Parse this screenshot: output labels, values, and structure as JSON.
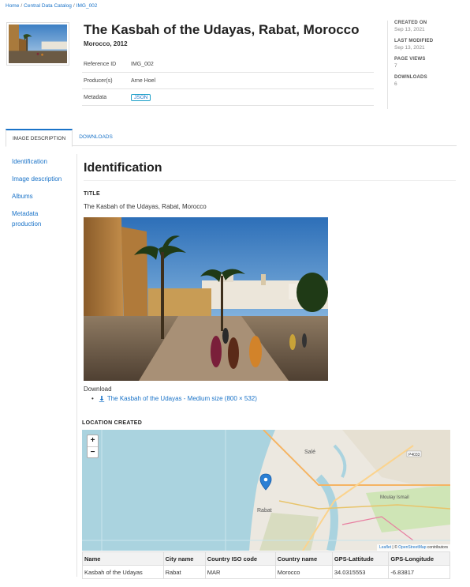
{
  "breadcrumb": {
    "home": "Home",
    "catalog": "Central Data Catalog",
    "current": "IMG_002",
    "separator": "/"
  },
  "header": {
    "title": "The Kasbah of the Udayas, Rabat, Morocco",
    "subtitle": "Morocco, 2012"
  },
  "meta": {
    "reference_id_label": "Reference ID",
    "reference_id": "IMG_002",
    "producer_label": "Producer(s)",
    "producer": "Arne Hoel",
    "metadata_label": "Metadata",
    "metadata_badge": "JSON"
  },
  "stats": {
    "created_label": "CREATED ON",
    "created": "Sep 13, 2021",
    "modified_label": "LAST MODIFIED",
    "modified": "Sep 13, 2021",
    "views_label": "PAGE VIEWS",
    "views": "7",
    "downloads_label": "DOWNLOADS",
    "downloads": "6"
  },
  "tabs": {
    "description": "IMAGE DESCRIPTION",
    "downloads": "DOWNLOADS"
  },
  "leftnav": {
    "identification": "Identification",
    "image_description": "Image description",
    "albums": "Albums",
    "metadata_production": "Metadata production"
  },
  "section": {
    "title": "Identification",
    "title_label": "TITLE",
    "title_value": "The Kasbah of the Udayas, Rabat, Morocco",
    "download_label": "Download",
    "download_link": "The Kasbah of the Udayas - Medium size (800 × 532)"
  },
  "location": {
    "title": "LOCATION CREATED",
    "zoom_in": "+",
    "zoom_out": "−",
    "map_labels": {
      "sale": "Salé",
      "rabat": "Rabat",
      "moulay": "Moulay Ismail",
      "road": "P4033"
    },
    "attribution_leaflet": "Leaflet",
    "attribution_sep": " | © ",
    "attribution_osm": "OpenStreetMap",
    "attribution_tail": " contributors",
    "columns": [
      "Name",
      "City name",
      "Country ISO code",
      "Country name",
      "GPS-Lattitude",
      "GPS-Longitude"
    ],
    "row": [
      "Kasbah of the Udayas",
      "Rabat",
      "MAR",
      "Morocco",
      "34.0315553",
      "-6.83817"
    ]
  },
  "colors": {
    "link": "#1a73c8",
    "sea": "#aad3df",
    "marker": "#2b7fd4"
  }
}
